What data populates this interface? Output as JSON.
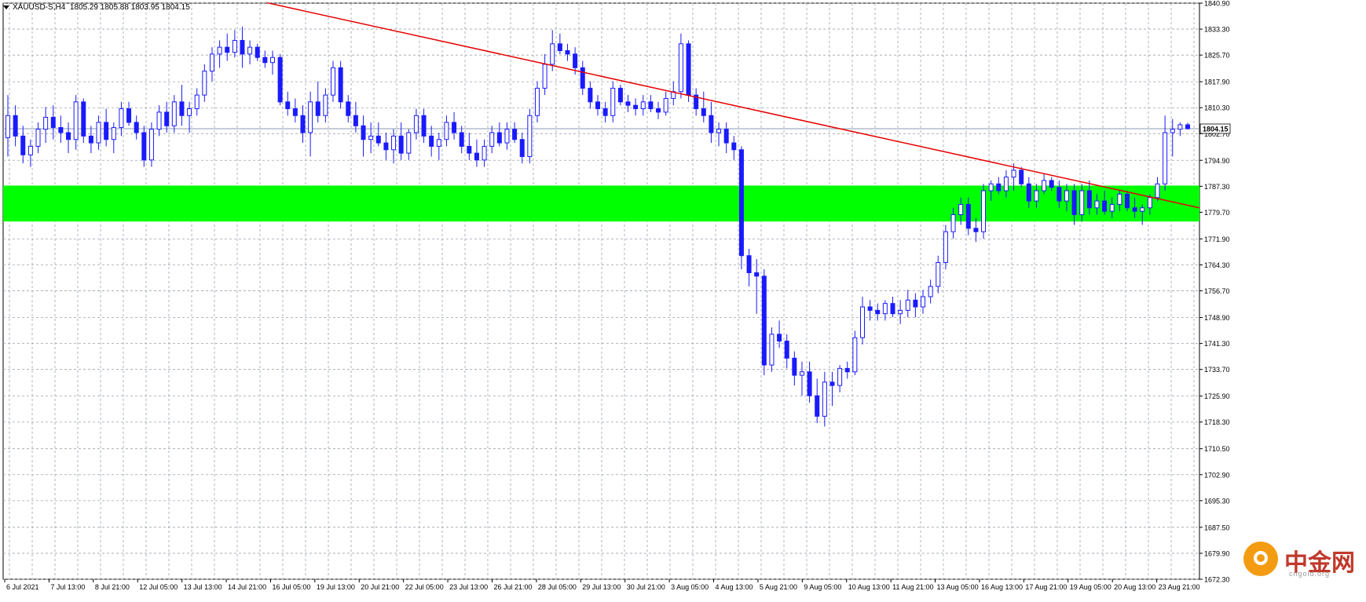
{
  "header": {
    "symbol": "XAUUSD-S",
    "timeframe": "H4",
    "ohlc": "1805.29 1805.88 1803.95 1804.15"
  },
  "price_axis": {
    "labels": [
      "1840.90",
      "1833.30",
      "1825.70",
      "1817.90",
      "1810.30",
      "1802.70",
      "1794.90",
      "1787.30",
      "1779.70",
      "1771.90",
      "1764.30",
      "1756.70",
      "1748.90",
      "1741.30",
      "1733.70",
      "1725.90",
      "1718.30",
      "1710.50",
      "1702.90",
      "1695.30",
      "1687.50",
      "1679.90",
      "1672.30"
    ],
    "current_price": "1804.15"
  },
  "time_axis": {
    "labels": [
      "6 Jul 2021",
      "7 Jul 13:00",
      "8 Jul 21:00",
      "12 Jul 05:00",
      "13 Jul 13:00",
      "14 Jul 21:00",
      "16 Jul 05:00",
      "19 Jul 13:00",
      "20 Jul 21:00",
      "22 Jul 05:00",
      "23 Jul 13:00",
      "26 Jul 21:00",
      "28 Jul 05:00",
      "29 Jul 13:00",
      "30 Jul 21:00",
      "3 Aug 05:00",
      "4 Aug 13:00",
      "5 Aug 21:00",
      "9 Aug 05:00",
      "10 Aug 13:00",
      "11 Aug 21:00",
      "13 Aug 05:00",
      "16 Aug 13:00",
      "17 Aug 21:00",
      "19 Aug 05:00",
      "20 Aug 13:00",
      "23 Aug 21:00"
    ]
  },
  "watermark": {
    "text": "中金网",
    "sub": "cngold.org"
  },
  "colors": {
    "bull": "#1a1aff",
    "bear": "#1a1aff",
    "zone": "#00ff00",
    "trendline": "#e60000",
    "grid": "#9aa3ad",
    "price_line": "#8a9bb0"
  },
  "chart_data": {
    "type": "candlestick",
    "title": "XAUUSD-S,H4",
    "ylim": [
      1672.3,
      1840.9
    ],
    "support_zone": [
      1777.0,
      1787.5
    ],
    "trendline": {
      "from": [
        0,
        1841.0
      ],
      "to": [
        300,
        1781.0
      ]
    },
    "close_last": 1804.15,
    "candles": [
      [
        1801.5,
        1814.0,
        1796.0,
        1808.0
      ],
      [
        1808.0,
        1811.0,
        1799.0,
        1802.0
      ],
      [
        1802.0,
        1805.0,
        1794.0,
        1796.5
      ],
      [
        1796.5,
        1801.0,
        1793.0,
        1799.0
      ],
      [
        1799.0,
        1806.0,
        1797.0,
        1804.0
      ],
      [
        1804.0,
        1810.5,
        1800.0,
        1807.5
      ],
      [
        1807.5,
        1811.0,
        1801.0,
        1804.5
      ],
      [
        1804.5,
        1808.0,
        1800.0,
        1803.0
      ],
      [
        1803.0,
        1806.0,
        1797.0,
        1801.0
      ],
      [
        1801.0,
        1814.0,
        1798.0,
        1812.0
      ],
      [
        1812.0,
        1813.0,
        1800.0,
        1802.0
      ],
      [
        1802.0,
        1805.0,
        1797.0,
        1800.0
      ],
      [
        1800.0,
        1808.0,
        1798.0,
        1806.0
      ],
      [
        1806.0,
        1810.0,
        1799.0,
        1801.0
      ],
      [
        1801.0,
        1806.0,
        1797.0,
        1804.5
      ],
      [
        1804.5,
        1812.0,
        1802.0,
        1810.0
      ],
      [
        1810.0,
        1812.0,
        1805.0,
        1806.0
      ],
      [
        1806.0,
        1808.0,
        1801.0,
        1803.0
      ],
      [
        1803.0,
        1805.0,
        1793.0,
        1795.0
      ],
      [
        1795.0,
        1806.0,
        1793.0,
        1804.0
      ],
      [
        1804.0,
        1811.0,
        1802.0,
        1809.0
      ],
      [
        1809.0,
        1812.0,
        1803.0,
        1805.0
      ],
      [
        1805.0,
        1814.0,
        1803.0,
        1812.0
      ],
      [
        1812.0,
        1817.0,
        1805.0,
        1808.0
      ],
      [
        1808.0,
        1812.0,
        1803.0,
        1810.0
      ],
      [
        1810.0,
        1816.0,
        1808.0,
        1814.0
      ],
      [
        1814.0,
        1823.0,
        1812.0,
        1821.0
      ],
      [
        1821.0,
        1828.0,
        1818.0,
        1826.0
      ],
      [
        1826.0,
        1830.0,
        1822.0,
        1828.0
      ],
      [
        1828.0,
        1832.0,
        1824.0,
        1826.5
      ],
      [
        1826.5,
        1833.0,
        1825.0,
        1830.0
      ],
      [
        1830.0,
        1834.0,
        1822.0,
        1826.0
      ],
      [
        1826.0,
        1830.0,
        1823.0,
        1828.0
      ],
      [
        1828.0,
        1829.0,
        1824.0,
        1825.0
      ],
      [
        1825.0,
        1827.0,
        1822.0,
        1823.5
      ],
      [
        1823.5,
        1827.0,
        1820.0,
        1825.0
      ],
      [
        1825.0,
        1826.0,
        1811.0,
        1812.0
      ],
      [
        1812.0,
        1815.0,
        1808.0,
        1810.0
      ],
      [
        1810.0,
        1813.0,
        1806.0,
        1808.0
      ],
      [
        1808.0,
        1811.0,
        1800.0,
        1803.0
      ],
      [
        1803.0,
        1815.0,
        1796.0,
        1812.0
      ],
      [
        1812.0,
        1818.0,
        1806.0,
        1808.0
      ],
      [
        1808.0,
        1816.0,
        1806.0,
        1814.0
      ],
      [
        1814.0,
        1824.0,
        1812.0,
        1822.0
      ],
      [
        1822.0,
        1824.0,
        1810.0,
        1812.0
      ],
      [
        1812.0,
        1814.0,
        1806.0,
        1808.0
      ],
      [
        1808.0,
        1812.0,
        1803.0,
        1805.0
      ],
      [
        1805.0,
        1808.0,
        1796.0,
        1801.0
      ],
      [
        1801.0,
        1806.0,
        1797.0,
        1802.0
      ],
      [
        1802.0,
        1806.0,
        1799.0,
        1800.0
      ],
      [
        1800.0,
        1803.0,
        1795.0,
        1798.0
      ],
      [
        1798.0,
        1804.0,
        1794.0,
        1802.0
      ],
      [
        1802.0,
        1806.0,
        1795.0,
        1797.0
      ],
      [
        1797.0,
        1804.0,
        1795.0,
        1803.0
      ],
      [
        1803.0,
        1810.0,
        1801.0,
        1808.0
      ],
      [
        1808.0,
        1810.0,
        1800.0,
        1802.0
      ],
      [
        1802.0,
        1805.0,
        1796.0,
        1799.0
      ],
      [
        1799.0,
        1803.0,
        1795.0,
        1801.0
      ],
      [
        1801.0,
        1808.0,
        1799.0,
        1806.0
      ],
      [
        1806.0,
        1809.0,
        1801.0,
        1803.0
      ],
      [
        1803.0,
        1805.0,
        1797.0,
        1799.0
      ],
      [
        1799.0,
        1803.0,
        1795.0,
        1797.0
      ],
      [
        1797.0,
        1801.0,
        1793.0,
        1795.0
      ],
      [
        1795.0,
        1801.0,
        1793.0,
        1799.0
      ],
      [
        1799.0,
        1805.0,
        1797.0,
        1803.0
      ],
      [
        1803.0,
        1806.0,
        1799.0,
        1800.0
      ],
      [
        1800.0,
        1806.0,
        1798.0,
        1804.0
      ],
      [
        1804.0,
        1806.0,
        1800.0,
        1801.0
      ],
      [
        1801.0,
        1803.0,
        1794.0,
        1796.0
      ],
      [
        1796.0,
        1810.0,
        1794.0,
        1808.0
      ],
      [
        1808.0,
        1818.0,
        1806.0,
        1816.0
      ],
      [
        1816.0,
        1826.0,
        1814.0,
        1823.0
      ],
      [
        1823.0,
        1833.0,
        1821.0,
        1829.0
      ],
      [
        1829.0,
        1832.0,
        1826.0,
        1827.0
      ],
      [
        1827.0,
        1829.0,
        1824.0,
        1826.0
      ],
      [
        1826.0,
        1828.0,
        1820.0,
        1822.0
      ],
      [
        1822.0,
        1824.0,
        1814.0,
        1816.0
      ],
      [
        1816.0,
        1818.0,
        1810.0,
        1812.0
      ],
      [
        1812.0,
        1814.0,
        1808.0,
        1810.0
      ],
      [
        1810.0,
        1812.0,
        1806.0,
        1808.0
      ],
      [
        1808.0,
        1818.0,
        1806.0,
        1816.0
      ],
      [
        1816.0,
        1817.0,
        1811.0,
        1812.0
      ],
      [
        1812.0,
        1814.0,
        1809.0,
        1811.0
      ],
      [
        1811.0,
        1813.0,
        1808.0,
        1810.0
      ],
      [
        1810.0,
        1814.0,
        1808.0,
        1812.0
      ],
      [
        1812.0,
        1814.0,
        1809.0,
        1810.0
      ],
      [
        1810.0,
        1812.0,
        1807.0,
        1809.0
      ],
      [
        1809.0,
        1815.0,
        1808.0,
        1813.0
      ],
      [
        1813.0,
        1818.0,
        1811.0,
        1815.0
      ],
      [
        1815.0,
        1832.0,
        1813.0,
        1829.0
      ],
      [
        1829.0,
        1830.0,
        1812.0,
        1814.0
      ],
      [
        1814.0,
        1816.0,
        1808.0,
        1810.0
      ],
      [
        1810.0,
        1815.0,
        1806.0,
        1808.0
      ],
      [
        1808.0,
        1812.0,
        1800.0,
        1803.0
      ],
      [
        1803.0,
        1806.0,
        1799.0,
        1804.0
      ],
      [
        1804.0,
        1806.0,
        1797.0,
        1800.0
      ],
      [
        1800.0,
        1802.0,
        1795.0,
        1798.0
      ],
      [
        1798.0,
        1799.0,
        1763.0,
        1767.0
      ],
      [
        1767.0,
        1769.0,
        1758.0,
        1762.0
      ],
      [
        1762.0,
        1766.0,
        1750.0,
        1761.0
      ],
      [
        1761.0,
        1763.0,
        1732.0,
        1735.0
      ],
      [
        1735.0,
        1746.0,
        1733.0,
        1744.0
      ],
      [
        1744.0,
        1748.0,
        1740.0,
        1742.0
      ],
      [
        1742.0,
        1744.0,
        1734.0,
        1737.0
      ],
      [
        1737.0,
        1739.0,
        1729.0,
        1732.0
      ],
      [
        1732.0,
        1736.0,
        1726.0,
        1733.0
      ],
      [
        1733.0,
        1736.0,
        1724.0,
        1726.0
      ],
      [
        1726.0,
        1731.0,
        1718.0,
        1720.0
      ],
      [
        1720.0,
        1733.0,
        1717.0,
        1730.0
      ],
      [
        1730.0,
        1733.0,
        1723.0,
        1729.0
      ],
      [
        1729.0,
        1735.0,
        1727.0,
        1734.0
      ],
      [
        1734.0,
        1736.0,
        1731.0,
        1733.0
      ],
      [
        1733.0,
        1745.0,
        1732.0,
        1743.0
      ],
      [
        1743.0,
        1755.0,
        1741.0,
        1752.0
      ],
      [
        1752.0,
        1754.0,
        1748.0,
        1751.0
      ],
      [
        1751.0,
        1753.0,
        1748.0,
        1750.0
      ],
      [
        1750.0,
        1754.0,
        1748.0,
        1753.0
      ],
      [
        1753.0,
        1755.0,
        1749.0,
        1750.0
      ],
      [
        1750.0,
        1754.0,
        1747.0,
        1751.0
      ],
      [
        1751.0,
        1757.0,
        1749.0,
        1754.0
      ],
      [
        1754.0,
        1756.0,
        1749.0,
        1752.0
      ],
      [
        1752.0,
        1757.0,
        1750.0,
        1755.0
      ],
      [
        1755.0,
        1760.0,
        1753.0,
        1758.0
      ],
      [
        1758.0,
        1767.0,
        1756.0,
        1765.0
      ],
      [
        1765.0,
        1776.0,
        1763.0,
        1774.0
      ],
      [
        1774.0,
        1781.0,
        1772.0,
        1779.0
      ],
      [
        1779.0,
        1784.0,
        1776.0,
        1782.0
      ],
      [
        1782.0,
        1784.0,
        1773.0,
        1775.0
      ],
      [
        1775.0,
        1778.0,
        1771.0,
        1774.0
      ],
      [
        1774.0,
        1788.0,
        1772.0,
        1786.0
      ],
      [
        1786.0,
        1789.0,
        1783.0,
        1788.0
      ],
      [
        1788.0,
        1790.0,
        1785.0,
        1786.0
      ],
      [
        1786.0,
        1792.0,
        1784.0,
        1790.0
      ],
      [
        1790.0,
        1794.0,
        1786.0,
        1792.0
      ],
      [
        1792.0,
        1793.0,
        1787.0,
        1788.0
      ],
      [
        1788.0,
        1790.0,
        1781.0,
        1783.0
      ],
      [
        1783.0,
        1788.0,
        1781.0,
        1786.0
      ],
      [
        1786.0,
        1791.0,
        1785.0,
        1789.0
      ],
      [
        1789.0,
        1790.0,
        1786.0,
        1787.0
      ],
      [
        1787.0,
        1789.0,
        1781.0,
        1783.0
      ],
      [
        1783.0,
        1788.0,
        1780.0,
        1786.0
      ],
      [
        1786.0,
        1788.0,
        1776.0,
        1779.0
      ],
      [
        1779.0,
        1788.0,
        1777.0,
        1786.0
      ],
      [
        1786.0,
        1789.0,
        1779.0,
        1781.0
      ],
      [
        1781.0,
        1785.0,
        1779.0,
        1783.0
      ],
      [
        1783.0,
        1786.0,
        1779.0,
        1780.0
      ],
      [
        1780.0,
        1784.0,
        1778.0,
        1782.0
      ],
      [
        1782.0,
        1786.0,
        1780.0,
        1785.0
      ],
      [
        1785.0,
        1786.0,
        1780.0,
        1781.0
      ],
      [
        1781.0,
        1784.0,
        1778.0,
        1780.0
      ],
      [
        1780.0,
        1782.0,
        1776.0,
        1781.0
      ],
      [
        1781.0,
        1785.0,
        1779.0,
        1784.0
      ],
      [
        1784.0,
        1790.0,
        1783.0,
        1788.0
      ],
      [
        1788.0,
        1808.0,
        1786.0,
        1803.0
      ],
      [
        1803.0,
        1807.0,
        1796.0,
        1804.0
      ],
      [
        1804.0,
        1806.0,
        1802.0,
        1805.3
      ],
      [
        1805.3,
        1805.9,
        1803.9,
        1804.15
      ]
    ]
  }
}
